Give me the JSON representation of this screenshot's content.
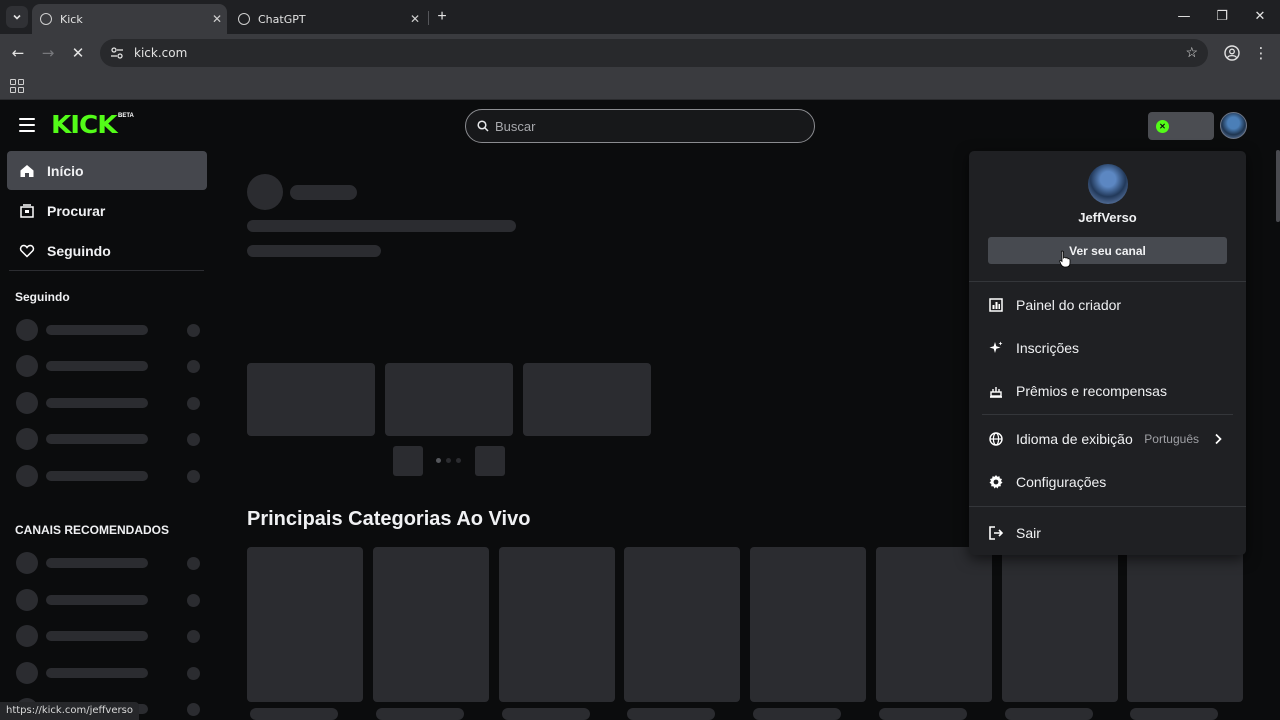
{
  "browser": {
    "tabs": [
      {
        "title": "Kick",
        "active": true
      },
      {
        "title": "ChatGPT",
        "active": false
      }
    ],
    "url": "kick.com",
    "status_url": "https://kick.com/jeffverso"
  },
  "header": {
    "logo_text": "KICK",
    "logo_badge": "BETA",
    "search_placeholder": "Buscar",
    "accent_color": "#53fc18"
  },
  "sidebar": {
    "nav": [
      {
        "label": "Início",
        "icon": "home-icon",
        "active": true
      },
      {
        "label": "Procurar",
        "icon": "browse-icon",
        "active": false
      },
      {
        "label": "Seguindo",
        "icon": "heart-icon",
        "active": false
      }
    ],
    "following_heading": "Seguindo",
    "recommended_heading": "CANAIS RECOMENDADOS"
  },
  "main": {
    "section_title": "Principais Categorias Ao Vivo"
  },
  "user_menu": {
    "username": "JeffVerso",
    "view_channel_label": "Ver seu canal",
    "items": [
      {
        "label": "Painel do criador",
        "icon": "bar-chart-icon"
      },
      {
        "label": "Inscrições",
        "icon": "sparkle-icon"
      },
      {
        "label": "Prêmios e recompensas",
        "icon": "rewards-icon"
      },
      {
        "label": "Idioma de exibição",
        "icon": "globe-icon",
        "value": "Português"
      },
      {
        "label": "Configurações",
        "icon": "gear-icon"
      },
      {
        "label": "Sair",
        "icon": "logout-icon"
      }
    ]
  }
}
